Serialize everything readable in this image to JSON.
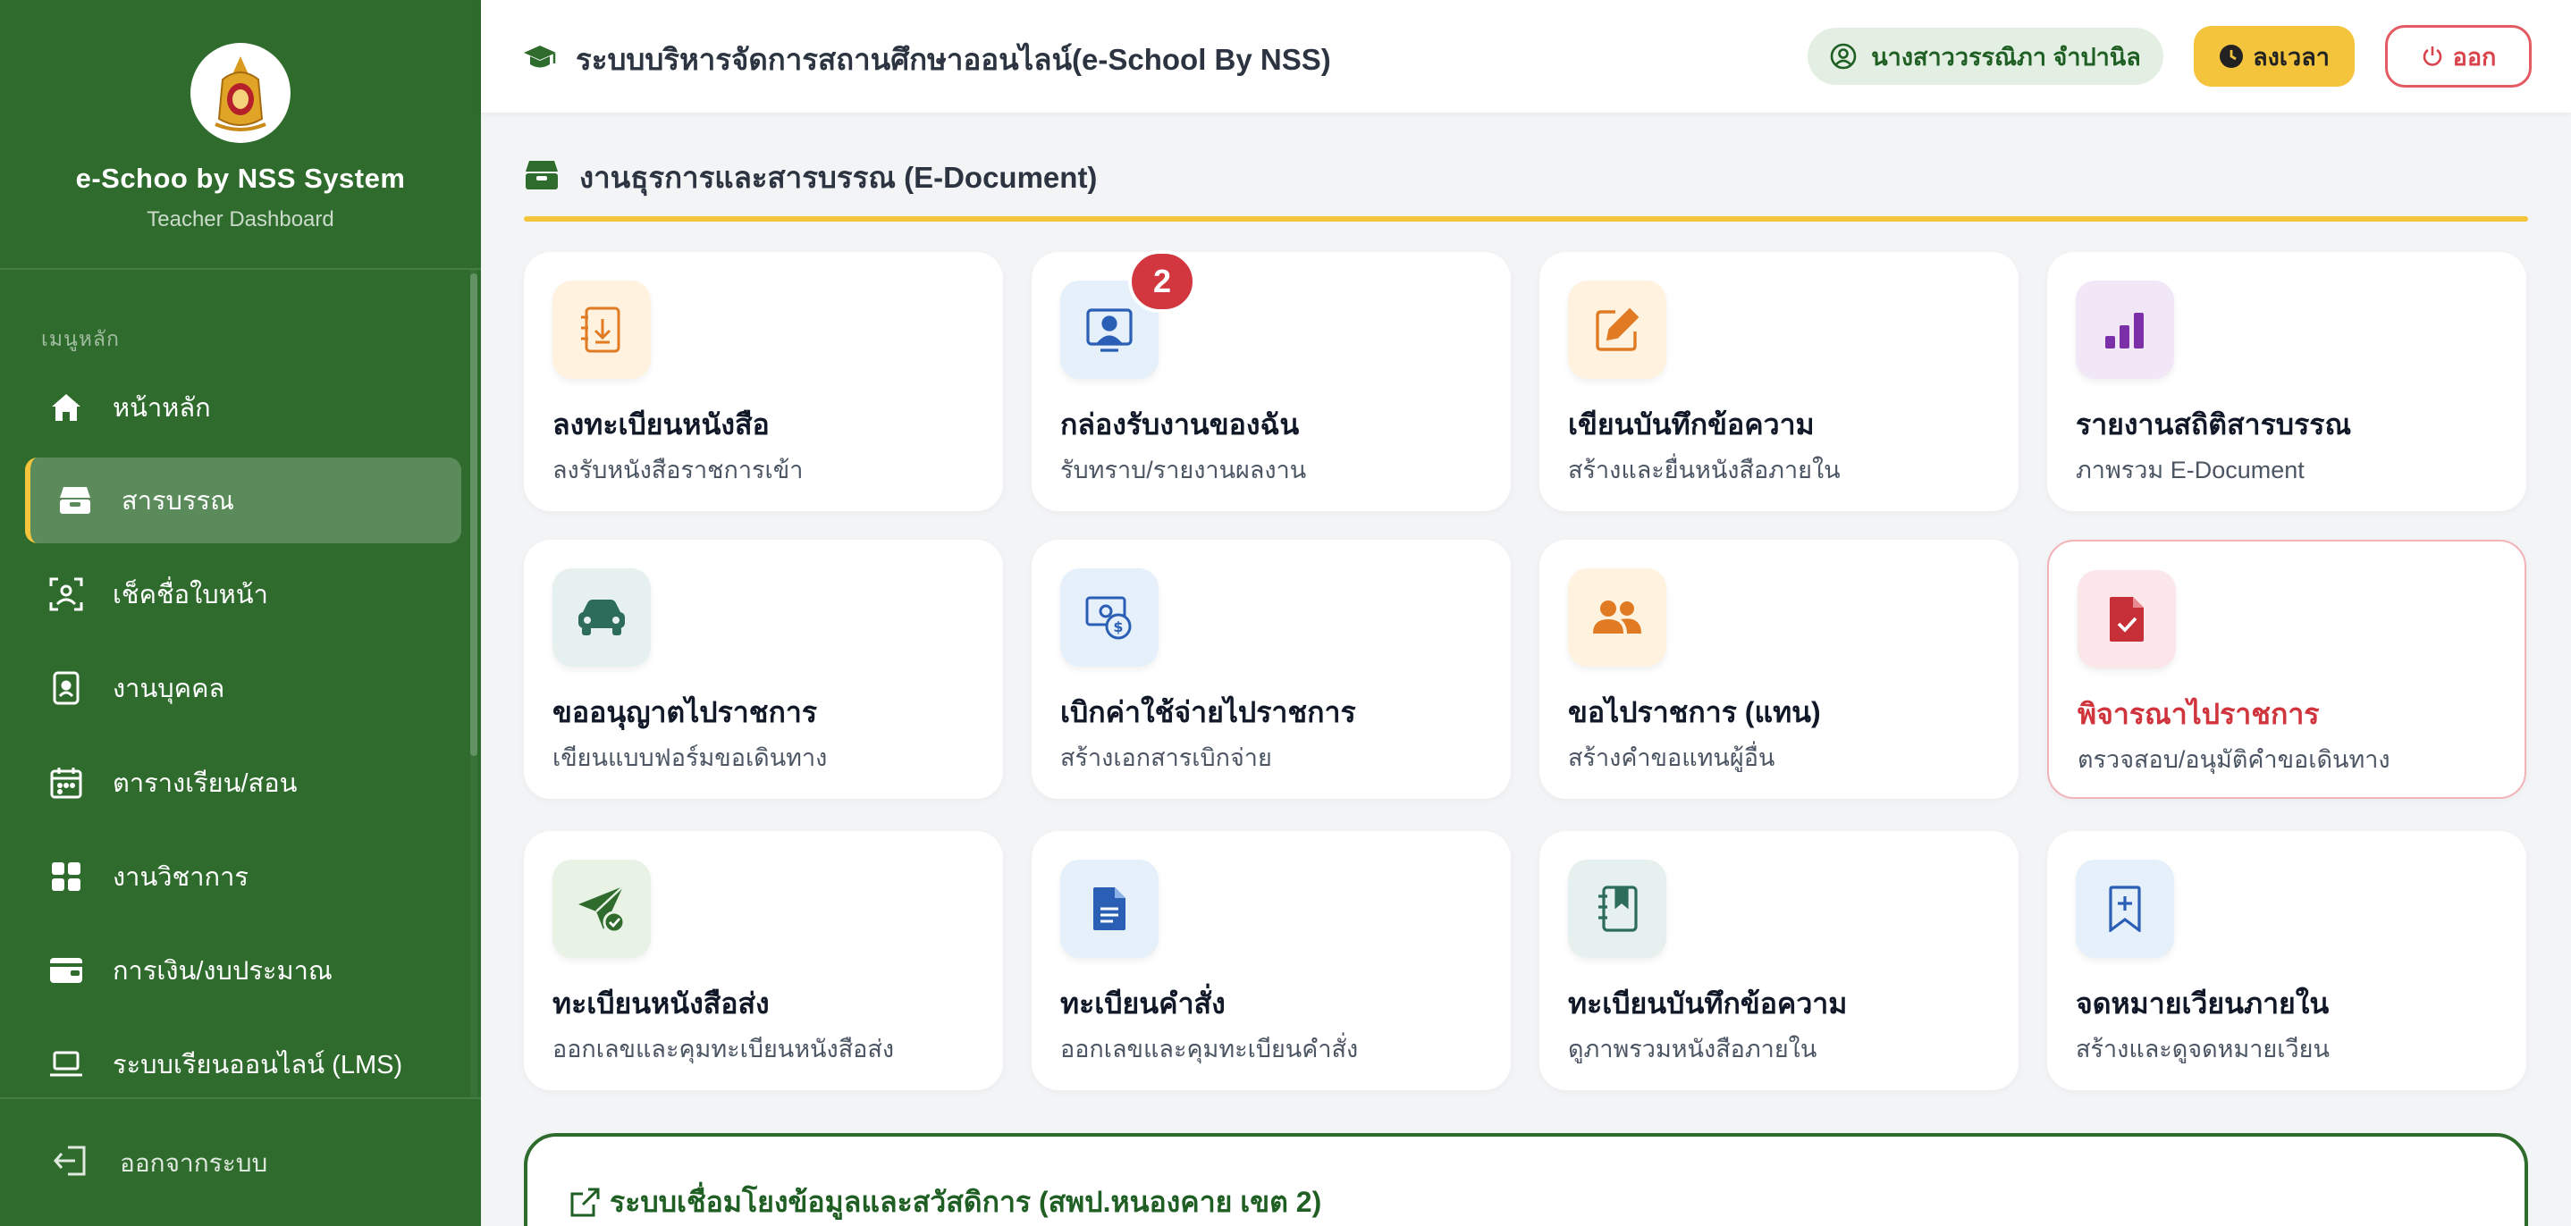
{
  "brand": {
    "title": "e-Schoo by NSS System",
    "subtitle": "Teacher Dashboard"
  },
  "sidebar": {
    "heading": "เมนูหลัก",
    "items": [
      {
        "label": "หน้าหลัก",
        "icon": "home-icon"
      },
      {
        "label": "สารบรรณ",
        "icon": "inbox-box-icon",
        "active": true
      },
      {
        "label": "เช็คชื่อใบหน้า",
        "icon": "face-scan-icon"
      },
      {
        "label": "งานบุคคล",
        "icon": "id-badge-icon"
      },
      {
        "label": "ตารางเรียน/สอน",
        "icon": "calendar-icon"
      },
      {
        "label": "งานวิชาการ",
        "icon": "grid-icon"
      },
      {
        "label": "การเงิน/งบประมาณ",
        "icon": "wallet-icon"
      },
      {
        "label": "ระบบเรียนออนไลน์ (LMS)",
        "icon": "laptop-icon"
      }
    ],
    "logout_label": "ออกจากระบบ"
  },
  "topbar": {
    "title": "ระบบบริหารจัดการสถานศึกษาออนไลน์(e-School By NSS)",
    "user_name": "นางสาววรรณิภา จำปานิล",
    "clock_label": "ลงเวลา",
    "exit_label": "ออก"
  },
  "section": {
    "title": "งานธุรการและสารบรรณ (E-Document)"
  },
  "cards": [
    {
      "title": "ลงทะเบียนหนังสือ",
      "subtitle": "ลงรับหนังสือราชการเข้า",
      "icon": "document-import-icon"
    },
    {
      "title": "กล่องรับงานของฉัน",
      "subtitle": "รับทราบ/รายงานผลงาน",
      "icon": "user-inbox-icon",
      "badge": "2"
    },
    {
      "title": "เขียนบันทึกข้อความ",
      "subtitle": "สร้างและยื่นหนังสือภายใน",
      "icon": "edit-icon"
    },
    {
      "title": "รายงานสถิติสารบรรณ",
      "subtitle": "ภาพรวม E-Document",
      "icon": "bar-chart-icon"
    },
    {
      "title": "ขออนุญาตไปราชการ",
      "subtitle": "เขียนแบบฟอร์มขอเดินทาง",
      "icon": "car-icon"
    },
    {
      "title": "เบิกค่าใช้จ่ายไปราชการ",
      "subtitle": "สร้างเอกสารเบิกจ่าย",
      "icon": "money-icon"
    },
    {
      "title": "ขอไปราชการ (แทน)",
      "subtitle": "สร้างคำขอแทนผู้อื่น",
      "icon": "users-icon"
    },
    {
      "title": "พิจารณาไปราชการ",
      "subtitle": "ตรวจสอบ/อนุมัติคำขอเดินทาง",
      "icon": "file-check-icon",
      "alert": true
    },
    {
      "title": "ทะเบียนหนังสือส่ง",
      "subtitle": "ออกเลขและคุมทะเบียนหนังสือส่ง",
      "icon": "send-check-icon"
    },
    {
      "title": "ทะเบียนคำสั่ง",
      "subtitle": "ออกเลขและคุมทะเบียนคำสั่ง",
      "icon": "file-text-icon"
    },
    {
      "title": "ทะเบียนบันทึกข้อความ",
      "subtitle": "ดูภาพรวมหนังสือภายใน",
      "icon": "notebook-icon"
    },
    {
      "title": "จดหมายเวียนภายใน",
      "subtitle": "สร้างและดูจดหมายเวียน",
      "icon": "bookmark-plus-icon"
    }
  ],
  "linked_system": {
    "title": "ระบบเชื่อมโยงข้อมูลและสวัสดิการ (สพป.หนองคาย เขต 2)"
  },
  "colors": {
    "sidebar": "#2e6b2c",
    "accent": "#f5c43d",
    "danger": "#d2363f"
  }
}
